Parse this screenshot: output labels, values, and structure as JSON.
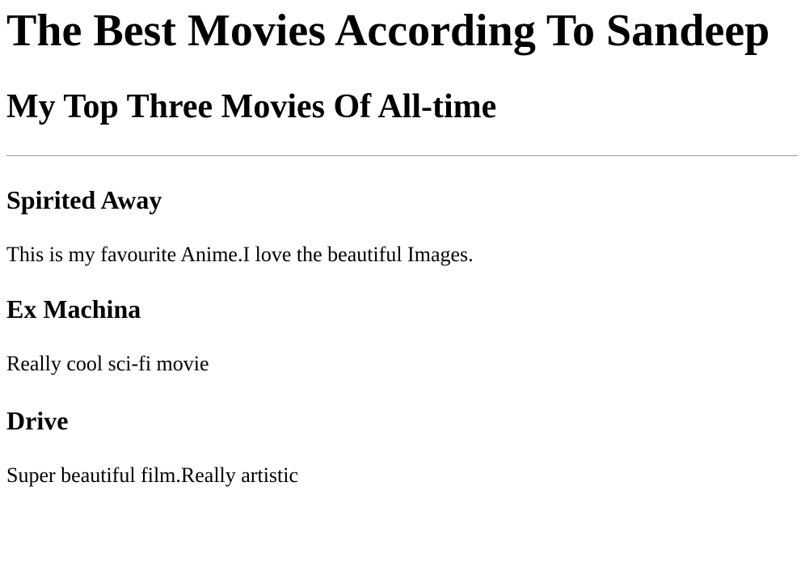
{
  "page": {
    "title": "The Best Movies According To Sandeep",
    "subtitle": "My Top Three Movies Of All-time"
  },
  "movies": [
    {
      "name": "Spirited Away",
      "description": "This is my favourite Anime.I love the beautiful Images."
    },
    {
      "name": "Ex Machina",
      "description": "Really cool sci-fi movie"
    },
    {
      "name": "Drive",
      "description": "Super beautiful film.Really artistic"
    }
  ]
}
